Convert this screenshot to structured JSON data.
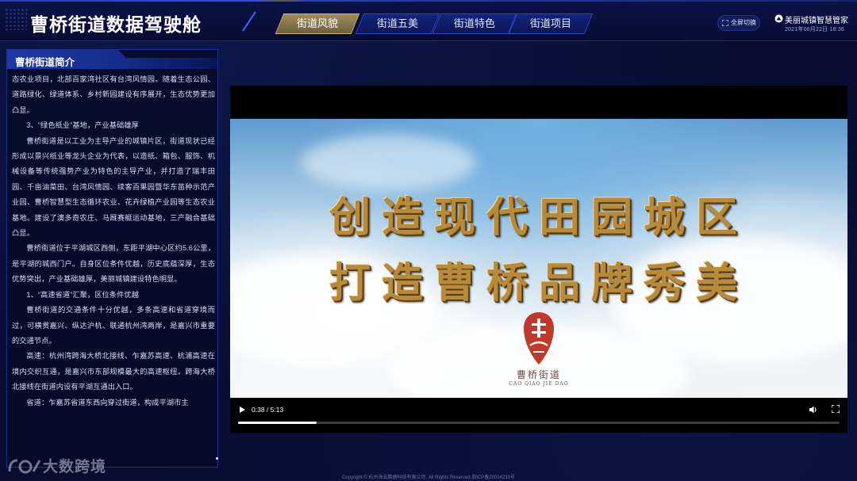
{
  "header": {
    "title": "曹桥街道数据驾驶舱",
    "tabs": [
      {
        "label": "街道风貌",
        "active": true
      },
      {
        "label": "街道五美",
        "active": false
      },
      {
        "label": "街道特色",
        "active": false
      },
      {
        "label": "街道项目",
        "active": false
      }
    ],
    "fullscreen_label": "全屏切换",
    "brand": "美丽城镇智慧管家",
    "datetime": "2021年06月22日  18:36"
  },
  "panel": {
    "title": "曹桥街道简介",
    "paragraphs": [
      {
        "text": "态农业项目，北部百家湾社区有台湾风情园。随着生态公园、道路绿化、绿道体系、乡村新园建设有序展开，生态优势更加凸显。",
        "indent": false
      },
      {
        "text": "3、“绿色纸业”基地，产业基础雄厚",
        "indent": true
      },
      {
        "text": "曹桥街道是以工业为主导产业的城镇片区，街道现状已经形成以景兴纸业等龙头企业为代表，以造纸、箱包、服饰、机械设备等传统强势产业为特色的主导产业，并打造了瑞丰田园、千亩油菜田、台湾风情园、续客百果园暨华东苗种示范产业园、曹桥智慧型生态循环农业、花卉绿植产业园等生态农业基地。建设了澳多奇农庄、马厩赛艇运动基地，三产融合基础凸显。",
        "indent": true
      },
      {
        "text": "曹桥街道位于平湖城区西侧，东距平湖中心区约5.6公里，是平湖的城西门户。自身区位条件优越，历史底蕴深厚，生态优势突出，产业基础雄厚，美丽城镇建设特色明显。",
        "indent": true
      },
      {
        "text": "1、“高速省道”汇聚，区位条件优越",
        "indent": true
      },
      {
        "text": "曹桥街道的交通条件十分优越，多条高速和省道穿境而过，可横贯嘉兴、纵达沪杭、联通杭州湾两岸，是嘉兴市重要的交通节点。",
        "indent": true
      },
      {
        "text": "高速：杭州湾跨海大桥北接线、乍嘉苏高速、杭浦高速在境内交织互通，是嘉兴市东部规模最大的高速枢纽。跨海大桥北接线在街道内设有平湖互通出入口。",
        "indent": true
      },
      {
        "text": "省道：乍嘉苏省道东西向穿过街道，构成平湖市主",
        "indent": true
      }
    ]
  },
  "video": {
    "slogan_line1": "创造现代田园城区",
    "slogan_line2": "打造曹桥品牌秀美",
    "logo_name": "曹桥街道",
    "logo_pinyin": "CAO QIAO JIE DAO",
    "logo_seal_text": "曹",
    "time": "0:38 / 5:13",
    "progress": 0.13,
    "colors": {
      "gold": "#b88a3c",
      "seal_red": "#c0392b"
    }
  },
  "footer": {
    "copyright": "Copyright © 杭州海云数据科技有限公司. All Rights Reserved.浙ICP备20014233号"
  },
  "watermark": {
    "text": "大数跨境"
  },
  "icons": [
    "fullscreen-icon",
    "brand-icon",
    "play-icon",
    "volume-icon",
    "fullscreen-video-icon",
    "watermark-logo-icon"
  ]
}
